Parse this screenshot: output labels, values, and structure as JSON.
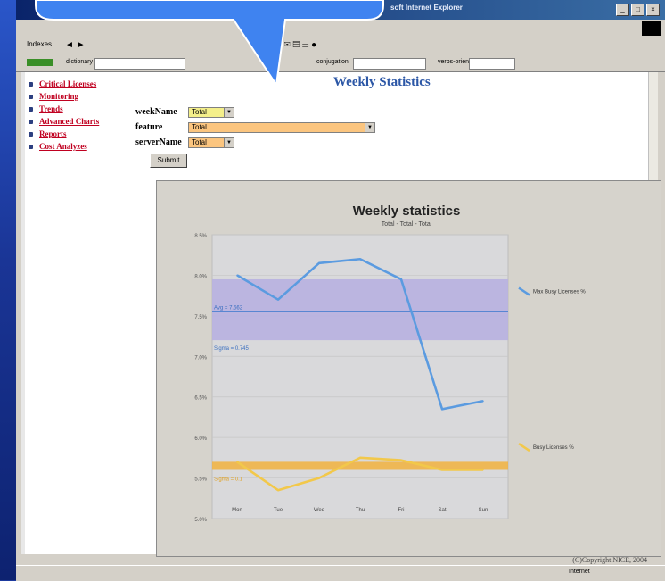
{
  "window": {
    "title": "soft Internet Explorer"
  },
  "toolbar": {
    "links_label": "Indexes",
    "fields": [
      "dictionary",
      "conjugation",
      "verbs-orient"
    ]
  },
  "nav": {
    "items": [
      {
        "label": "Critical Licenses"
      },
      {
        "label": "Monitoring"
      },
      {
        "label": "Trends"
      },
      {
        "label": "Advanced Charts"
      },
      {
        "label": "Reports"
      },
      {
        "label": "Cost Analyzes"
      }
    ]
  },
  "page": {
    "title": "Weekly Statistics"
  },
  "form": {
    "weekName_label": "weekName",
    "weekName_value": "Total",
    "feature_label": "feature",
    "feature_value": "Total",
    "serverName_label": "serverName",
    "serverName_value": "Total",
    "submit_label": "Submit"
  },
  "colors": {
    "max_series": "#5b9be0",
    "busy_series": "#f2c84a",
    "band_max": "#b7b0e0",
    "band_busy": "#f0b447"
  },
  "chart_data": {
    "type": "line",
    "title": "Weekly statistics",
    "subtitle": "Total - Total - Total",
    "categories": [
      "Mon",
      "Tue",
      "Wed",
      "Thu",
      "Fri",
      "Sat",
      "Sun"
    ],
    "yticks": [
      "8.5%",
      "8.0%",
      "7.5%",
      "7.0%",
      "6.5%",
      "6.0%",
      "5.5%",
      "5.0%"
    ],
    "ylim": [
      5.0,
      8.5
    ],
    "series": [
      {
        "name": "Max Busy Licenses %",
        "values": [
          8.0,
          7.7,
          8.15,
          8.2,
          7.95,
          6.35,
          6.45
        ]
      },
      {
        "name": "Busy Licenses %",
        "values": [
          5.7,
          5.35,
          5.5,
          5.75,
          5.72,
          5.6,
          5.6
        ]
      }
    ],
    "annotations": {
      "max_avg_label": "Avg = 7.562",
      "max_sigma_label": "Sigma = 0.745",
      "busy_sigma_label": "Sigma = 0.1"
    },
    "bands": {
      "max": {
        "avg": 7.55,
        "from": 7.2,
        "to": 7.95
      },
      "busy": {
        "from": 5.6,
        "to": 5.7
      }
    },
    "legend": "right"
  },
  "footer": {
    "copyright": "(C)Copyright NICE, 2004"
  },
  "status": {
    "zone": "Internet"
  }
}
